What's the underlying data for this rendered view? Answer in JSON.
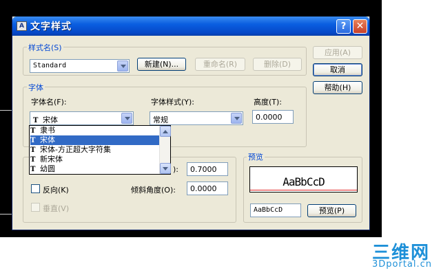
{
  "window": {
    "title": "文字样式",
    "help_symbol": "?",
    "close_symbol": "✕"
  },
  "style_name": {
    "group_label": "样式名(S)",
    "value": "Standard",
    "new_button": "新建(N)...",
    "rename_button": "重命名(R)",
    "delete_button": "删除(D)"
  },
  "side_buttons": {
    "apply": "应用(A)",
    "cancel": "取消",
    "help": "帮助(H)"
  },
  "font": {
    "group_label": "字体",
    "font_name_label": "字体名(F):",
    "font_name_value": "宋体",
    "font_style_label": "字体样式(Y):",
    "font_style_value": "常规",
    "height_label": "高度(T):",
    "height_value": "0.0000",
    "dropdown_items": [
      {
        "label": "隶书",
        "selected": false
      },
      {
        "label": "宋体",
        "selected": true
      },
      {
        "label": "宋体-方正超大字符集",
        "selected": false
      },
      {
        "label": "新宋体",
        "selected": false
      },
      {
        "label": "幼圆",
        "selected": false
      }
    ],
    "tt_glyph": "T"
  },
  "effects": {
    "width_label": "):",
    "width_value": "0.7000",
    "backwards_label": "反向(K)",
    "oblique_label": "倾斜角度(O):",
    "oblique_value": "0.0000",
    "vertical_label": "垂直(V)"
  },
  "preview": {
    "group_label": "预览",
    "sample_text": "AaBbCcD",
    "input_value": "AaBbCcD",
    "preview_button": "预览(P)"
  },
  "watermark": {
    "big": "三维网",
    "small": "3Dportal.cn"
  },
  "colors": {
    "title_bar": "#0a5ee0",
    "accent_label": "#0046d5",
    "selection": "#316ac5",
    "preview_line": "#e02020",
    "watermark": "#1e90d8"
  }
}
